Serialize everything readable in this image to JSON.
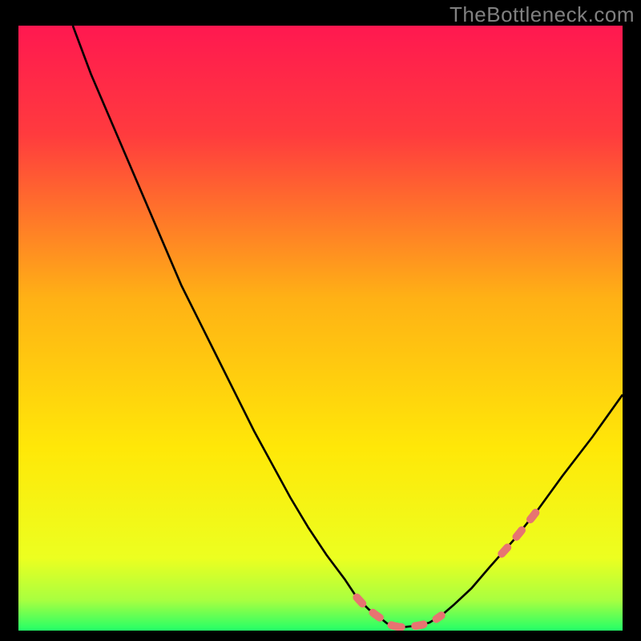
{
  "watermark": "TheBottleneck.com",
  "chart_data": {
    "type": "line",
    "title": "",
    "xlabel": "",
    "ylabel": "",
    "xlim": [
      0,
      100
    ],
    "ylim": [
      0,
      100
    ],
    "series": [
      {
        "name": "bottleneck-curve",
        "color": "#000000",
        "x": [
          9,
          12,
          15,
          18,
          21,
          24,
          27,
          30,
          33,
          36,
          39,
          42,
          45,
          48,
          51,
          54,
          56,
          58,
          60,
          61,
          62,
          63,
          64,
          66,
          68,
          70,
          72,
          75,
          78,
          82,
          86,
          90,
          95,
          100
        ],
        "y": [
          100,
          92,
          85,
          78,
          71,
          64,
          57,
          51,
          45,
          39,
          33,
          27.5,
          22,
          17,
          12.5,
          8.5,
          5.5,
          3.5,
          2,
          1.2,
          0.8,
          0.6,
          0.6,
          0.8,
          1.3,
          2.5,
          4.2,
          7,
          10.5,
          15,
          20,
          25.5,
          32,
          39
        ]
      },
      {
        "name": "highlight-left",
        "color": "#e77471",
        "dashed": true,
        "x": [
          56,
          57,
          58,
          59,
          60,
          61,
          62
        ],
        "y": [
          5.5,
          4.4,
          3.5,
          2.7,
          2.0,
          1.2,
          0.8
        ]
      },
      {
        "name": "highlight-bottom",
        "color": "#e77471",
        "dashed": true,
        "x": [
          62,
          63,
          64,
          65,
          66,
          67,
          68,
          69,
          70
        ],
        "y": [
          0.8,
          0.6,
          0.6,
          0.7,
          0.8,
          1.0,
          1.3,
          1.8,
          2.5
        ]
      },
      {
        "name": "highlight-right",
        "color": "#e77471",
        "dashed": true,
        "x": [
          80,
          81,
          82,
          83,
          84,
          85,
          86
        ],
        "y": [
          12.7,
          13.8,
          15.0,
          16.2,
          17.5,
          18.7,
          20.0
        ]
      }
    ],
    "gradient_stops": [
      {
        "pos": 0.0,
        "color": "#ff1850"
      },
      {
        "pos": 0.18,
        "color": "#ff3b3e"
      },
      {
        "pos": 0.45,
        "color": "#ffb115"
      },
      {
        "pos": 0.7,
        "color": "#ffe808"
      },
      {
        "pos": 0.88,
        "color": "#ecff20"
      },
      {
        "pos": 0.95,
        "color": "#a8ff40"
      },
      {
        "pos": 1.0,
        "color": "#23ff68"
      }
    ]
  }
}
